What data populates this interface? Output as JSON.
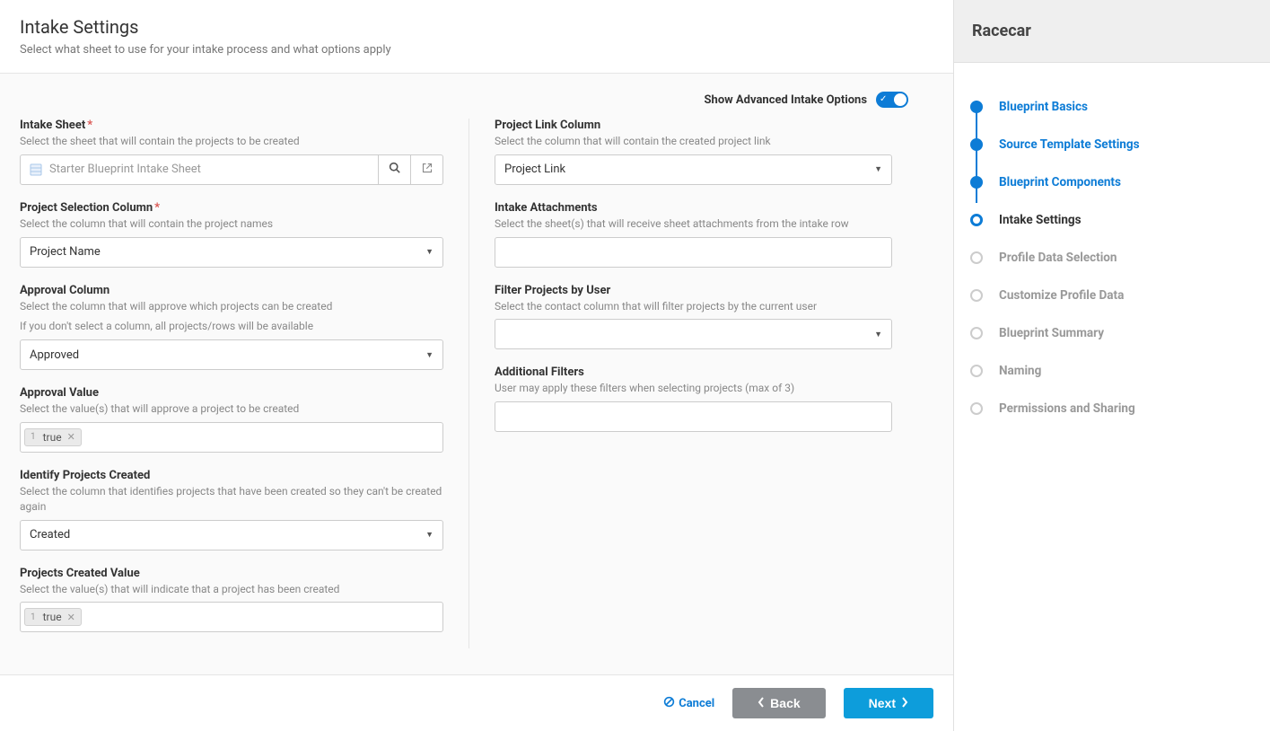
{
  "header": {
    "title": "Intake Settings",
    "subtitle": "Select what sheet to use for your intake process and what options apply"
  },
  "advanced_toggle": {
    "label": "Show Advanced Intake Options",
    "enabled": true
  },
  "left": {
    "intake_sheet": {
      "label": "Intake Sheet",
      "required": true,
      "help": "Select the sheet that will contain the projects to be created",
      "value": "Starter Blueprint Intake Sheet"
    },
    "project_selection": {
      "label": "Project Selection Column",
      "required": true,
      "help": "Select the column that will contain the project names",
      "value": "Project Name"
    },
    "approval_column": {
      "label": "Approval Column",
      "help1": "Select the column that will approve which projects can be created",
      "help2": "If you don't select a column, all projects/rows will be available",
      "value": "Approved"
    },
    "approval_value": {
      "label": "Approval Value",
      "help": "Select the value(s) that will approve a project to be created",
      "tag_num": "1",
      "tag_text": "true"
    },
    "identify_created": {
      "label": "Identify Projects Created",
      "help": "Select the column that identifies projects that have been created so they can't be created again",
      "value": "Created"
    },
    "created_value": {
      "label": "Projects Created Value",
      "help": "Select the value(s) that will indicate that a project has been created",
      "tag_num": "1",
      "tag_text": "true"
    }
  },
  "right": {
    "project_link": {
      "label": "Project Link Column",
      "help": "Select the column that will contain the created project link",
      "value": "Project Link"
    },
    "intake_attachments": {
      "label": "Intake Attachments",
      "help": "Select the sheet(s) that will receive sheet attachments from the intake row"
    },
    "filter_by_user": {
      "label": "Filter Projects by User",
      "help": "Select the contact column that will filter projects by the current user"
    },
    "additional_filters": {
      "label": "Additional Filters",
      "help": "User may apply these filters when selecting projects (max of 3)"
    }
  },
  "footer": {
    "cancel": "Cancel",
    "back": "Back",
    "next": "Next"
  },
  "sidebar": {
    "title": "Racecar",
    "steps": [
      {
        "label": "Blueprint Basics",
        "state": "done"
      },
      {
        "label": "Source Template Settings",
        "state": "done"
      },
      {
        "label": "Blueprint Components",
        "state": "done"
      },
      {
        "label": "Intake Settings",
        "state": "current"
      },
      {
        "label": "Profile Data Selection",
        "state": "todo"
      },
      {
        "label": "Customize Profile Data",
        "state": "todo"
      },
      {
        "label": "Blueprint Summary",
        "state": "todo"
      },
      {
        "label": "Naming",
        "state": "todo"
      },
      {
        "label": "Permissions and Sharing",
        "state": "todo"
      }
    ]
  }
}
